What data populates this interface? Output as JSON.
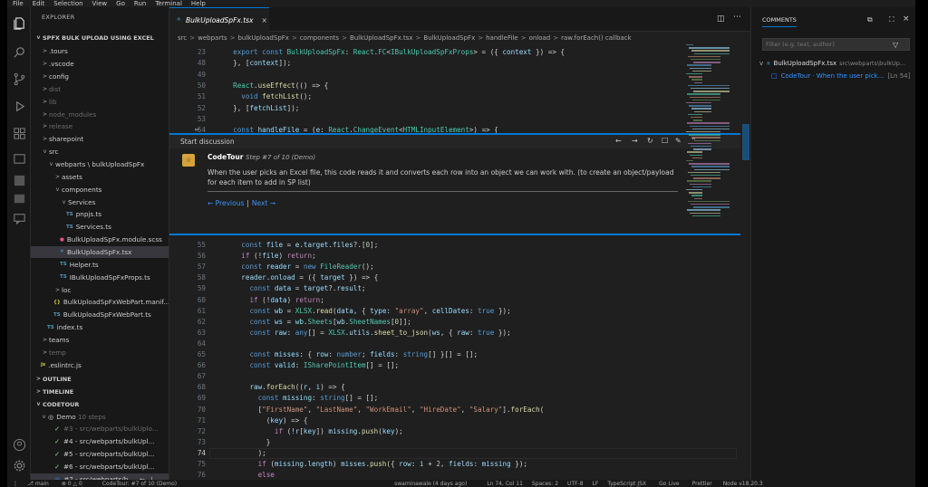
{
  "titlebar": {
    "title": "SPFx Bulk Upload Using Excel",
    "menus": [
      "File",
      "Edit",
      "Selection",
      "View",
      "Go",
      "Run",
      "Terminal",
      "Help"
    ]
  },
  "explorer": {
    "header": "EXPLORER",
    "project": "SPFX BULK UPLOAD USING EXCEL",
    "tree": [
      {
        "label": ".tours",
        "depth": 1,
        "chev": ">",
        "dim": false
      },
      {
        "label": ".vscode",
        "depth": 1,
        "chev": ">",
        "dim": false
      },
      {
        "label": "config",
        "depth": 1,
        "chev": ">",
        "dim": false
      },
      {
        "label": "dist",
        "depth": 1,
        "chev": ">",
        "dim": true
      },
      {
        "label": "lib",
        "depth": 1,
        "chev": ">",
        "dim": true
      },
      {
        "label": "node_modules",
        "depth": 1,
        "chev": ">",
        "dim": true
      },
      {
        "label": "release",
        "depth": 1,
        "chev": ">",
        "dim": true
      },
      {
        "label": "sharepoint",
        "depth": 1,
        "chev": ">",
        "dim": false
      },
      {
        "label": "src",
        "depth": 1,
        "chev": "v",
        "dim": false
      },
      {
        "label": "webparts \\ bulkUploadSpFx",
        "depth": 2,
        "chev": "v",
        "dim": false
      },
      {
        "label": "assets",
        "depth": 3,
        "chev": ">",
        "dim": false
      },
      {
        "label": "components",
        "depth": 3,
        "chev": "v",
        "dim": false
      },
      {
        "label": "Services",
        "depth": 4,
        "chev": "v",
        "dim": false
      },
      {
        "label": "pnpjs.ts",
        "depth": 5,
        "icon": "TS",
        "dim": false
      },
      {
        "label": "Services.ts",
        "depth": 5,
        "icon": "TS",
        "dim": false
      },
      {
        "label": "BulkUploadSpFx.module.scss",
        "depth": 4,
        "icon": "scss",
        "dim": false
      },
      {
        "label": "BulkUploadSpFx.tsx",
        "depth": 4,
        "icon": "tsx",
        "dim": false,
        "selected": true
      },
      {
        "label": "Helper.ts",
        "depth": 4,
        "icon": "TS",
        "dim": false
      },
      {
        "label": "IBulkUploadSpFxProps.ts",
        "depth": 4,
        "icon": "TS",
        "dim": false
      },
      {
        "label": "loc",
        "depth": 3,
        "chev": ">",
        "dim": false
      },
      {
        "label": "BulkUploadSpFxWebPart.manif...",
        "depth": 3,
        "icon": "{}",
        "dim": false
      },
      {
        "label": "BulkUploadSpFxWebPart.ts",
        "depth": 3,
        "icon": "TS",
        "dim": false
      },
      {
        "label": "index.ts",
        "depth": 2,
        "icon": "TS",
        "dim": false
      },
      {
        "label": "teams",
        "depth": 1,
        "chev": ">",
        "dim": false
      },
      {
        "label": "temp",
        "depth": 1,
        "chev": ">",
        "dim": true
      },
      {
        "label": ".eslintrc.js",
        "depth": 1,
        "icon": "js",
        "dim": false
      }
    ],
    "sections": {
      "outline": "OUTLINE",
      "timeline": "TIMELINE",
      "codetour": "CODETOUR"
    },
    "tour": {
      "name": "Demo",
      "steps": "10 steps"
    },
    "steps": [
      {
        "label": "#3 - src/webparts/bulkUplo..."
      },
      {
        "label": "#4 - src/webparts/bulkUpl..."
      },
      {
        "label": "#5 - src/webparts/bulkUpl..."
      },
      {
        "label": "#6 - src/webparts/bulkUpl..."
      },
      {
        "label": "#7 - src/webparts/b..."
      }
    ]
  },
  "editor": {
    "tab": "BulkUploadSpFx.tsx",
    "breadcrumb": [
      "src",
      "webparts",
      "bulkUploadSpFx",
      "components",
      "BulkUploadSpFx.tsx",
      "BulkUploadSpFx",
      "handleFile",
      "onload",
      "raw.forEach() callback"
    ],
    "top_lines": [
      {
        "n": "23",
        "code": "  export const BulkUploadSpFx: React.FC<IBulkUploadSpFxProps> = ({ context }) => {"
      },
      {
        "n": "48",
        "code": "  }, [context]);"
      },
      {
        "n": "49",
        "code": ""
      },
      {
        "n": "50",
        "code": "  React.useEffect(() => {"
      },
      {
        "n": "51",
        "code": "    void fetchList();"
      },
      {
        "n": "52",
        "code": "  }, [fetchList]);"
      },
      {
        "n": "53",
        "code": ""
      },
      {
        "n": "54",
        "code": "  const handleFile = (e: React.ChangeEvent<HTMLInputElement>) => {"
      }
    ],
    "bottom_lines": [
      {
        "n": "55",
        "code": "    const file = e.target.files?.[0];"
      },
      {
        "n": "56",
        "code": "    if (!file) return;"
      },
      {
        "n": "57",
        "code": "    const reader = new FileReader();"
      },
      {
        "n": "58",
        "code": "    reader.onload = ({ target }) => {"
      },
      {
        "n": "59",
        "code": "      const data = target?.result;"
      },
      {
        "n": "60",
        "code": "      if (!data) return;"
      },
      {
        "n": "61",
        "code": "      const wb = XLSX.read(data, { type: \"array\", cellDates: true });"
      },
      {
        "n": "62",
        "code": "      const ws = wb.Sheets[wb.SheetNames[0]];"
      },
      {
        "n": "63",
        "code": "      const raw: any[] = XLSX.utils.sheet_to_json(ws, { raw: true });"
      },
      {
        "n": "64",
        "code": ""
      },
      {
        "n": "65",
        "code": "      const misses: { row: number; fields: string[] }[] = [];"
      },
      {
        "n": "66",
        "code": "      const valid: ISharePointItem[] = [];"
      },
      {
        "n": "67",
        "code": ""
      },
      {
        "n": "68",
        "code": "      raw.forEach((r, i) => {"
      },
      {
        "n": "69",
        "code": "        const missing: string[] = [];"
      },
      {
        "n": "70",
        "code": "        [\"FirstName\", \"LastName\", \"WorkEmail\", \"HireDate\", \"Salary\"].forEach("
      },
      {
        "n": "71",
        "code": "          (key) => {"
      },
      {
        "n": "72",
        "code": "            if (!r[key]) missing.push(key);"
      },
      {
        "n": "73",
        "code": "          }"
      },
      {
        "n": "74",
        "code": "        );"
      },
      {
        "n": "75",
        "code": "        if (missing.length) misses.push({ row: i + 2, fields: missing });"
      },
      {
        "n": "76",
        "code": "        else"
      },
      {
        "n": "77",
        "code": "          valid.push({"
      }
    ]
  },
  "discussion": {
    "header": "Start discussion",
    "author": "CodeTour",
    "step": "Step #7 of 10 (Demo)",
    "body": "When the user picks an Excel file, this code reads it and converts each row into an object we can work with. (to create an object/payload for each item to add in SP list)",
    "prev": "← Previous",
    "sep": "|",
    "next": "Next →"
  },
  "comments": {
    "header": "COMMENTS",
    "filter_placeholder": "Filter (e.g. text, author)",
    "file": "BulkUploadSpFx.tsx",
    "path": "src\\webparts\\bulkUp...",
    "thread": "CodeTour · When the user pick...",
    "line": "[Ln 54]"
  },
  "status": {
    "branch": "main",
    "errors": "0",
    "warnings": "0",
    "tour": "CodeTour: #7 of 10 (Demo)",
    "blame": "swaminawale (4 days ago)",
    "position": "Ln 74, Col 11",
    "spaces": "Spaces: 2",
    "encoding": "UTF-8",
    "eol": "LF",
    "language": "TypeScript JSX",
    "golive": "Go Live",
    "prettier": "Prettier",
    "node": "Node v18.20.3"
  },
  "colors": {
    "accent": "#0078d4",
    "sidebar": "#181818",
    "editor": "#1f1f1f"
  }
}
